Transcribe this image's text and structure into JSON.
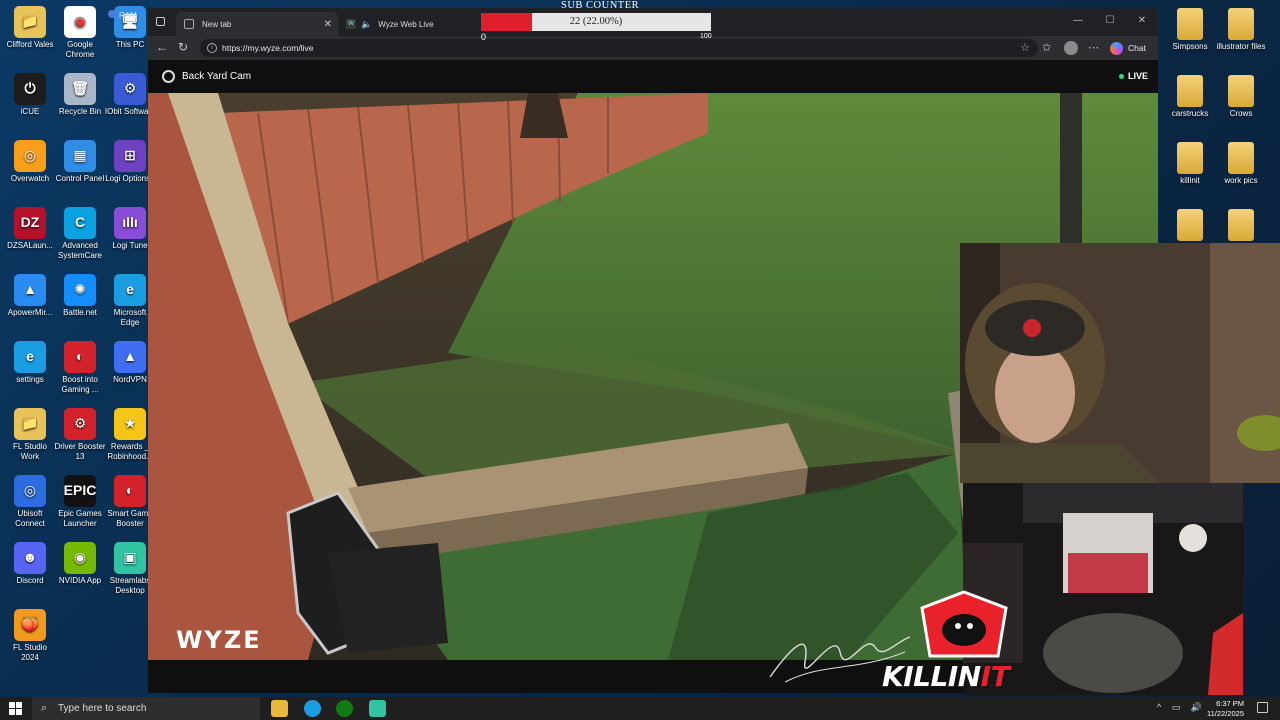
{
  "desktop": {
    "left_icons": [
      {
        "label": "Clifford Vales",
        "color": "#e8c35a",
        "glyph": "📁"
      },
      {
        "label": "Google Chrome",
        "color": "#ffffff",
        "glyph": "◉"
      },
      {
        "label": "This PC",
        "color": "#2f8de4",
        "glyph": "🖥"
      },
      {
        "label": "iCUE",
        "color": "#1d1d1d",
        "glyph": "⏻"
      },
      {
        "label": "Recycle Bin",
        "color": "#a9b7c6",
        "glyph": "🗑"
      },
      {
        "label": "IObit Softwa...",
        "color": "#3b5bd6",
        "glyph": "⚙"
      },
      {
        "label": "Overwatch",
        "color": "#f99e1a",
        "glyph": "◎"
      },
      {
        "label": "Control Panel",
        "color": "#2f8de4",
        "glyph": "▦"
      },
      {
        "label": "Logi Options+",
        "color": "#6f42c1",
        "glyph": "⊞"
      },
      {
        "label": "DZSALaun...",
        "color": "#b3122a",
        "glyph": "DZ"
      },
      {
        "label": "Advanced SystemCare",
        "color": "#0aa2e0",
        "glyph": "C"
      },
      {
        "label": "Logi Tune",
        "color": "#8a4dd8",
        "glyph": "ıllı"
      },
      {
        "label": "ApowerMir...",
        "color": "#2a8cf0",
        "glyph": "▲"
      },
      {
        "label": "Battle.net",
        "color": "#148eff",
        "glyph": "✺"
      },
      {
        "label": "Microsoft Edge",
        "color": "#1b9de2",
        "glyph": "e"
      },
      {
        "label": "settings",
        "color": "#1b9de2",
        "glyph": "e"
      },
      {
        "label": "Boost into Gaming ...",
        "color": "#d3222a",
        "glyph": "◐"
      },
      {
        "label": "NordVPN",
        "color": "#3f6ff0",
        "glyph": "▲"
      },
      {
        "label": "FL Studio Work",
        "color": "#e8c35a",
        "glyph": "📁"
      },
      {
        "label": "Driver Booster 13",
        "color": "#d3222a",
        "glyph": "⚙"
      },
      {
        "label": "Rewards _ Robinhood...",
        "color": "#f5c518",
        "glyph": "★"
      },
      {
        "label": "Ubisoft Connect",
        "color": "#2d6be0",
        "glyph": "◎"
      },
      {
        "label": "Epic Games Launcher",
        "color": "#111111",
        "glyph": "EPIC"
      },
      {
        "label": "Smart Game Booster",
        "color": "#d3222a",
        "glyph": "◐"
      },
      {
        "label": "Discord",
        "color": "#5865f2",
        "glyph": "☻"
      },
      {
        "label": "NVIDIA App",
        "color": "#76b900",
        "glyph": "◉"
      },
      {
        "label": "Streamlabs Desktop",
        "color": "#31c3a2",
        "glyph": "▣"
      },
      {
        "label": "FL Studio 2024",
        "color": "#f29a1e",
        "glyph": "🍑"
      }
    ],
    "right_icons": [
      {
        "label": "Simpsons"
      },
      {
        "label": "illustrator files"
      },
      {
        "label": "carstrucks"
      },
      {
        "label": "Crows"
      },
      {
        "label": "killinit"
      },
      {
        "label": "work pics"
      }
    ],
    "ram_label": "RAM"
  },
  "browser": {
    "tabs": [
      {
        "label": "New tab"
      },
      {
        "label": "Wyze Web Live"
      }
    ],
    "url": "https://my.wyze.com/live",
    "chat_label": "Chat",
    "window_controls": [
      "—",
      "☐",
      "✕"
    ]
  },
  "camera": {
    "name": "Back Yard Cam",
    "status": "LIVE",
    "watermark": "WYZE"
  },
  "sub_counter": {
    "title": "SUB COUNTER",
    "progress_text": "22 (22.00%)",
    "progress_fraction": 0.22,
    "min_label": "0",
    "max_label": "100",
    "fill_color": "#e01e2e"
  },
  "logo": {
    "text_white": "KILLIN",
    "text_red": "IT"
  },
  "taskbar": {
    "search_placeholder": "Type here to search",
    "time": "6:37 PM",
    "date": "11/22/2025"
  }
}
